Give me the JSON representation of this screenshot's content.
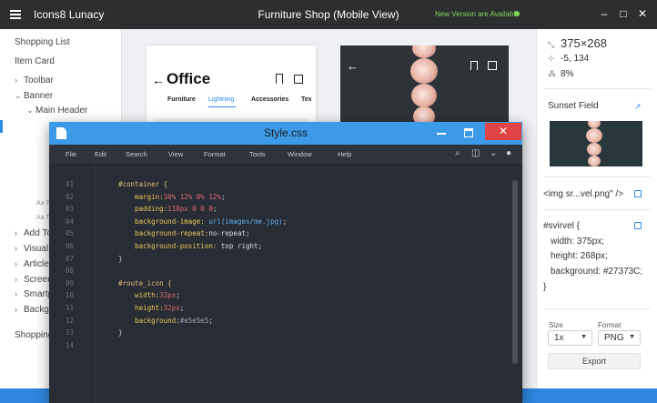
{
  "app": {
    "name": "Icons8 Lunacy",
    "document_title": "Furniture Shop (Mobile View)",
    "update_notice": "New Version are Available",
    "window_buttons": [
      "–",
      "□",
      "✕"
    ]
  },
  "layers": [
    {
      "label": "Shopping List",
      "chevron": ""
    },
    {
      "label": "Item Card",
      "chevron": ""
    },
    {
      "label": "Toolbar",
      "chevron": "›"
    },
    {
      "label": "Banner",
      "chevron": "⌄"
    },
    {
      "label": "Main Header",
      "chevron": "⌄"
    },
    {
      "label": "Add To",
      "chevron": "›"
    },
    {
      "label": "Visual",
      "chevron": "›"
    },
    {
      "label": "Article",
      "chevron": "›"
    },
    {
      "label": "Screen",
      "chevron": "›"
    },
    {
      "label": "Smartp",
      "chevron": "›"
    },
    {
      "label": "Backg",
      "chevron": "›"
    },
    {
      "label": "Shopping",
      "chevron": ""
    }
  ],
  "layer_text_markers": [
    "Aa T",
    "Aa T"
  ],
  "artboard_office": {
    "title": "Office",
    "tabs": [
      "Furniture",
      "Lightning",
      "Accessories",
      "Tex"
    ],
    "active_tab_index": 1
  },
  "props": {
    "size": "375×268",
    "position": "-5, 134",
    "opacity": "8%",
    "fill_name": "Sunset Field",
    "img_tag": "<img sr...vel.png\" />",
    "css_lines": [
      "#svirvel {",
      "width: 375px;",
      "height: 268px;",
      "background: #27373C;",
      "}"
    ],
    "size_label": "Size",
    "format_label": "Format",
    "size_value": "1x",
    "format_value": "PNG",
    "export_label": "Export"
  },
  "editor": {
    "title": "Style.css",
    "close_glyph": "✕",
    "menu": [
      "File",
      "Edit",
      "Search",
      "View",
      "Format",
      "Tools",
      "Window",
      "Help"
    ],
    "line_numbers": [
      "01",
      "02",
      "03",
      "04",
      "05",
      "06",
      "07",
      "08",
      "09",
      "10",
      "11",
      "12",
      "13",
      "14"
    ],
    "lines": [
      [
        {
          "t": "#container {",
          "c": "sel"
        }
      ],
      [
        {
          "t": "    margin:",
          "c": "prop"
        },
        {
          "t": "10% 12% 0% 12%",
          "c": "pct"
        },
        {
          "t": ";",
          "c": "plain"
        }
      ],
      [
        {
          "t": "    padding:",
          "c": "prop"
        },
        {
          "t": "110px 0 0 0",
          "c": "pct"
        },
        {
          "t": ";",
          "c": "plain"
        }
      ],
      [
        {
          "t": "    background-image: ",
          "c": "prop"
        },
        {
          "t": "url(images/me.jpg)",
          "c": "url"
        },
        {
          "t": ";",
          "c": "plain"
        }
      ],
      [
        {
          "t": "    background-repeat:",
          "c": "prop"
        },
        {
          "t": "no-repeat",
          "c": "plain"
        },
        {
          "t": ";",
          "c": "plain"
        }
      ],
      [
        {
          "t": "    background-position: ",
          "c": "prop"
        },
        {
          "t": "top right",
          "c": "plain"
        },
        {
          "t": ";",
          "c": "plain"
        }
      ],
      [
        {
          "t": "}",
          "c": "brace"
        }
      ],
      [
        {
          "t": "",
          "c": "plain"
        }
      ],
      [
        {
          "t": "#route_icon {",
          "c": "sel"
        }
      ],
      [
        {
          "t": "    width:",
          "c": "prop"
        },
        {
          "t": "32px",
          "c": "pct"
        },
        {
          "t": ";",
          "c": "plain"
        }
      ],
      [
        {
          "t": "    height:",
          "c": "prop"
        },
        {
          "t": "32px",
          "c": "pct"
        },
        {
          "t": ";",
          "c": "plain"
        }
      ],
      [
        {
          "t": "    background:",
          "c": "prop"
        },
        {
          "t": "#e5e5e5",
          "c": "col"
        },
        {
          "t": ";",
          "c": "plain"
        }
      ],
      [
        {
          "t": "}",
          "c": "brace"
        }
      ],
      [
        {
          "t": "",
          "c": "plain"
        }
      ]
    ]
  }
}
